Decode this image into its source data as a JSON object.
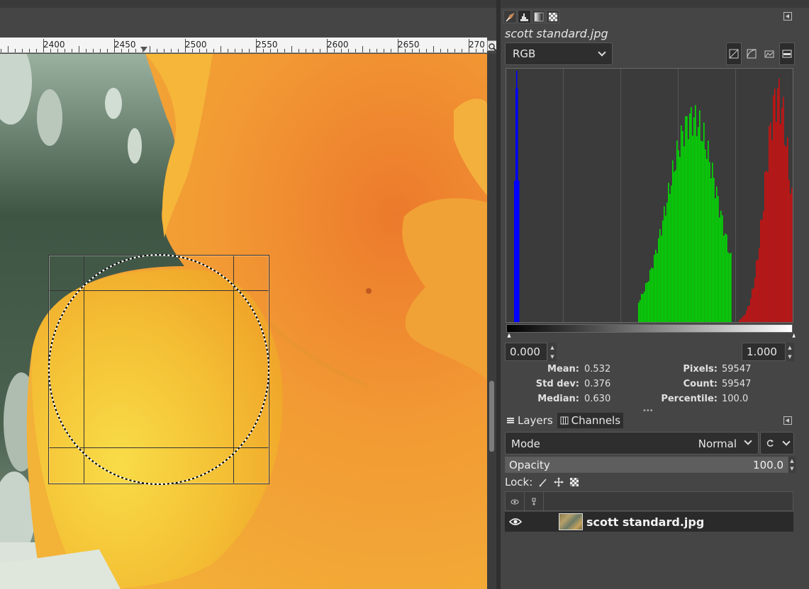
{
  "ruler": {
    "labels": [
      "2400",
      "2450",
      "2500",
      "2550",
      "2600",
      "2650",
      "270"
    ]
  },
  "histogram_dialog": {
    "image_name": "scott standard.jpg",
    "channel": "RGB",
    "range_min": "0.000",
    "range_max": "1.000",
    "stats": {
      "mean_label": "Mean:",
      "mean": "0.532",
      "stddev_label": "Std dev:",
      "stddev": "0.376",
      "median_label": "Median:",
      "median": "0.630",
      "pixels_label": "Pixels:",
      "pixels": "59547",
      "count_label": "Count:",
      "count": "59547",
      "percentile_label": "Percentile:",
      "percentile": "100.0"
    },
    "colors": {
      "blue": "#0000ff",
      "green": "#00e000",
      "red": "#d01010"
    }
  },
  "layers_dialog": {
    "tabs": [
      "Layers",
      "Channels"
    ],
    "mode_label": "Mode",
    "mode_value": "Normal",
    "opacity_label": "Opacity",
    "opacity_value": "100.0",
    "lock_label": "Lock:",
    "layers": [
      {
        "name": "scott standard.jpg",
        "visible": true
      }
    ]
  }
}
